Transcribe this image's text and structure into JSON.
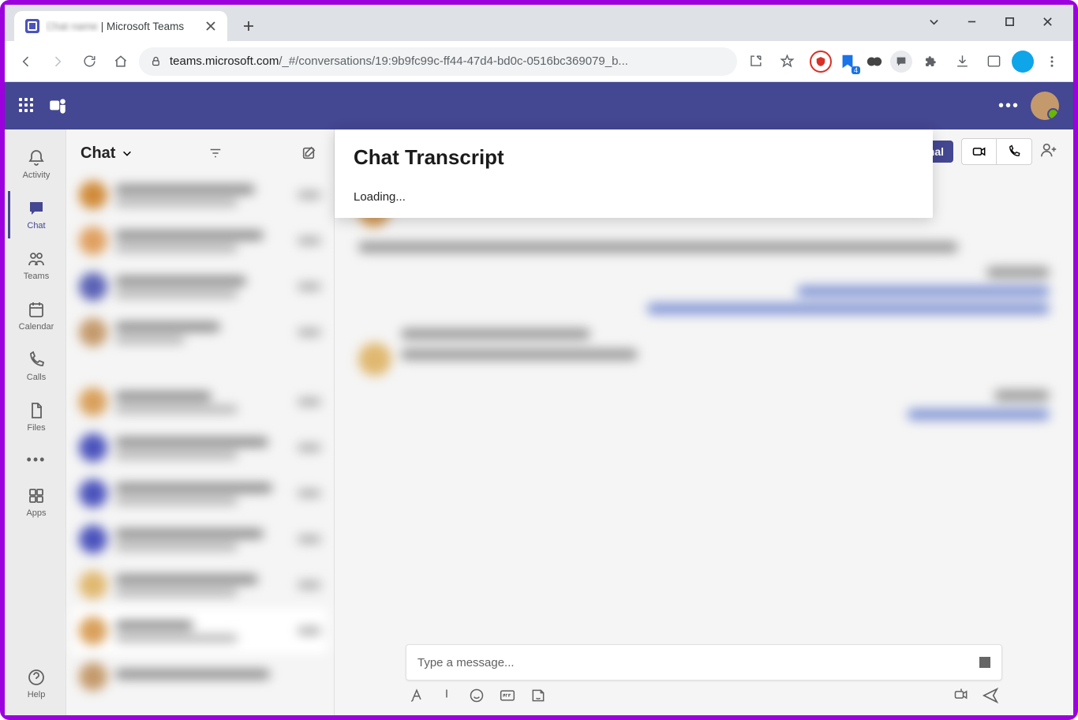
{
  "browser": {
    "tab_title_blur": "Chat name",
    "tab_title_suffix": " | Microsoft Teams",
    "url_domain": "teams.microsoft.com",
    "url_path": "/_#/conversations/19:9b9fc99c-ff44-47d4-bd0c-0516bc369079_b...",
    "extension_badge": "4"
  },
  "popup": {
    "title": "Chat Transcript",
    "status": "Loading..."
  },
  "rail": {
    "activity": "Activity",
    "chat": "Chat",
    "teams": "Teams",
    "calendar": "Calendar",
    "calls": "Calls",
    "files": "Files",
    "apps": "Apps",
    "help": "Help"
  },
  "chatlist": {
    "heading": "Chat"
  },
  "convo": {
    "external_badge": "ernal"
  },
  "compose": {
    "placeholder": "Type a message..."
  }
}
